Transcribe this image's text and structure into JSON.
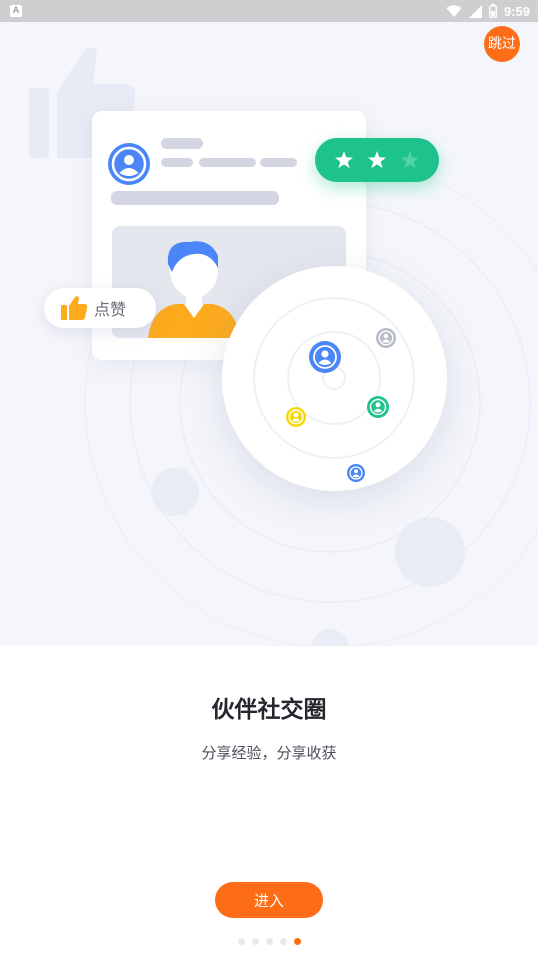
{
  "status_bar": {
    "time": "9:59",
    "app_badge": "A",
    "icons": [
      "app-notification-icon",
      "wifi-icon",
      "cell-signal-icon",
      "battery-icon"
    ]
  },
  "skip_button": {
    "label": "跳过"
  },
  "illustration": {
    "like_label": "点赞",
    "star_count": 3
  },
  "onboarding": {
    "title": "伙伴社交圈",
    "subtitle": "分享经验，分享收获",
    "enter_label": "进入"
  },
  "pager": {
    "total": 5,
    "active_index": 4
  },
  "colors": {
    "accent": "#fd6c16",
    "green": "#1ec28b",
    "blue": "#4a86f7",
    "yellow": "#f4d90e",
    "grey": "#b8bcc9",
    "background": "#f5f6fb"
  }
}
